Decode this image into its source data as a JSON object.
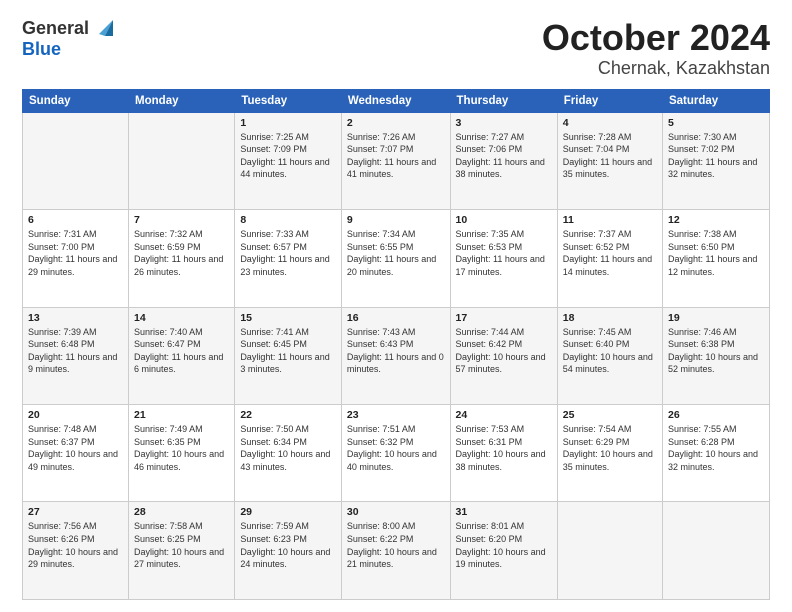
{
  "header": {
    "logo_general": "General",
    "logo_blue": "Blue",
    "title": "October 2024",
    "location": "Chernak, Kazakhstan"
  },
  "columns": [
    "Sunday",
    "Monday",
    "Tuesday",
    "Wednesday",
    "Thursday",
    "Friday",
    "Saturday"
  ],
  "rows": [
    [
      {
        "day": "",
        "content": ""
      },
      {
        "day": "",
        "content": ""
      },
      {
        "day": "1",
        "content": "Sunrise: 7:25 AM\nSunset: 7:09 PM\nDaylight: 11 hours and 44 minutes."
      },
      {
        "day": "2",
        "content": "Sunrise: 7:26 AM\nSunset: 7:07 PM\nDaylight: 11 hours and 41 minutes."
      },
      {
        "day": "3",
        "content": "Sunrise: 7:27 AM\nSunset: 7:06 PM\nDaylight: 11 hours and 38 minutes."
      },
      {
        "day": "4",
        "content": "Sunrise: 7:28 AM\nSunset: 7:04 PM\nDaylight: 11 hours and 35 minutes."
      },
      {
        "day": "5",
        "content": "Sunrise: 7:30 AM\nSunset: 7:02 PM\nDaylight: 11 hours and 32 minutes."
      }
    ],
    [
      {
        "day": "6",
        "content": "Sunrise: 7:31 AM\nSunset: 7:00 PM\nDaylight: 11 hours and 29 minutes."
      },
      {
        "day": "7",
        "content": "Sunrise: 7:32 AM\nSunset: 6:59 PM\nDaylight: 11 hours and 26 minutes."
      },
      {
        "day": "8",
        "content": "Sunrise: 7:33 AM\nSunset: 6:57 PM\nDaylight: 11 hours and 23 minutes."
      },
      {
        "day": "9",
        "content": "Sunrise: 7:34 AM\nSunset: 6:55 PM\nDaylight: 11 hours and 20 minutes."
      },
      {
        "day": "10",
        "content": "Sunrise: 7:35 AM\nSunset: 6:53 PM\nDaylight: 11 hours and 17 minutes."
      },
      {
        "day": "11",
        "content": "Sunrise: 7:37 AM\nSunset: 6:52 PM\nDaylight: 11 hours and 14 minutes."
      },
      {
        "day": "12",
        "content": "Sunrise: 7:38 AM\nSunset: 6:50 PM\nDaylight: 11 hours and 12 minutes."
      }
    ],
    [
      {
        "day": "13",
        "content": "Sunrise: 7:39 AM\nSunset: 6:48 PM\nDaylight: 11 hours and 9 minutes."
      },
      {
        "day": "14",
        "content": "Sunrise: 7:40 AM\nSunset: 6:47 PM\nDaylight: 11 hours and 6 minutes."
      },
      {
        "day": "15",
        "content": "Sunrise: 7:41 AM\nSunset: 6:45 PM\nDaylight: 11 hours and 3 minutes."
      },
      {
        "day": "16",
        "content": "Sunrise: 7:43 AM\nSunset: 6:43 PM\nDaylight: 11 hours and 0 minutes."
      },
      {
        "day": "17",
        "content": "Sunrise: 7:44 AM\nSunset: 6:42 PM\nDaylight: 10 hours and 57 minutes."
      },
      {
        "day": "18",
        "content": "Sunrise: 7:45 AM\nSunset: 6:40 PM\nDaylight: 10 hours and 54 minutes."
      },
      {
        "day": "19",
        "content": "Sunrise: 7:46 AM\nSunset: 6:38 PM\nDaylight: 10 hours and 52 minutes."
      }
    ],
    [
      {
        "day": "20",
        "content": "Sunrise: 7:48 AM\nSunset: 6:37 PM\nDaylight: 10 hours and 49 minutes."
      },
      {
        "day": "21",
        "content": "Sunrise: 7:49 AM\nSunset: 6:35 PM\nDaylight: 10 hours and 46 minutes."
      },
      {
        "day": "22",
        "content": "Sunrise: 7:50 AM\nSunset: 6:34 PM\nDaylight: 10 hours and 43 minutes."
      },
      {
        "day": "23",
        "content": "Sunrise: 7:51 AM\nSunset: 6:32 PM\nDaylight: 10 hours and 40 minutes."
      },
      {
        "day": "24",
        "content": "Sunrise: 7:53 AM\nSunset: 6:31 PM\nDaylight: 10 hours and 38 minutes."
      },
      {
        "day": "25",
        "content": "Sunrise: 7:54 AM\nSunset: 6:29 PM\nDaylight: 10 hours and 35 minutes."
      },
      {
        "day": "26",
        "content": "Sunrise: 7:55 AM\nSunset: 6:28 PM\nDaylight: 10 hours and 32 minutes."
      }
    ],
    [
      {
        "day": "27",
        "content": "Sunrise: 7:56 AM\nSunset: 6:26 PM\nDaylight: 10 hours and 29 minutes."
      },
      {
        "day": "28",
        "content": "Sunrise: 7:58 AM\nSunset: 6:25 PM\nDaylight: 10 hours and 27 minutes."
      },
      {
        "day": "29",
        "content": "Sunrise: 7:59 AM\nSunset: 6:23 PM\nDaylight: 10 hours and 24 minutes."
      },
      {
        "day": "30",
        "content": "Sunrise: 8:00 AM\nSunset: 6:22 PM\nDaylight: 10 hours and 21 minutes."
      },
      {
        "day": "31",
        "content": "Sunrise: 8:01 AM\nSunset: 6:20 PM\nDaylight: 10 hours and 19 minutes."
      },
      {
        "day": "",
        "content": ""
      },
      {
        "day": "",
        "content": ""
      }
    ]
  ]
}
